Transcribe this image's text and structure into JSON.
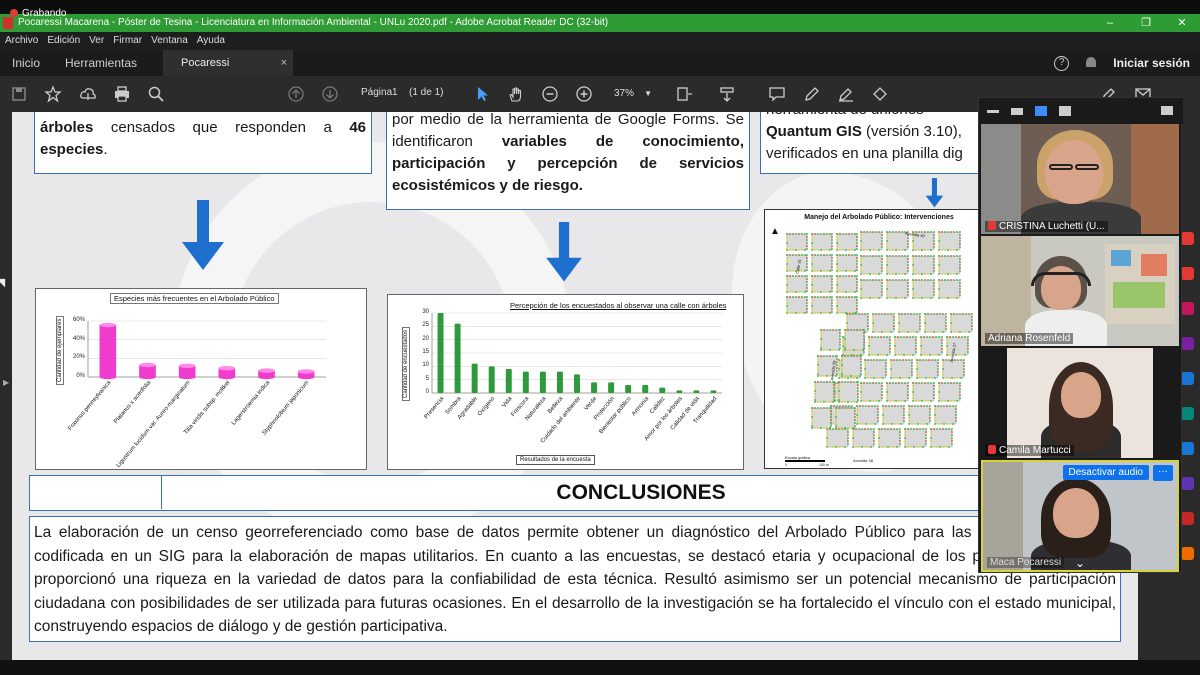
{
  "recording": {
    "label": "Grabando"
  },
  "window": {
    "title": "Pocaressi Macarena - Póster de Tesina - Licenciatura en Información Ambiental - UNLu 2020.pdf - Adobe Acrobat Reader DC (32-bit)",
    "controls": [
      "–",
      "❐",
      "✕"
    ]
  },
  "menu": [
    "Archivo",
    "Edición",
    "Ver",
    "Firmar",
    "Ventana",
    "Ayuda"
  ],
  "tabs": {
    "home": "Inicio",
    "tools": "Herramientas",
    "document": "Pocaressi Macarena...",
    "close": "×",
    "help_icon": "?",
    "login": "Iniciar sesión"
  },
  "toolbar": {
    "page_label": "Página",
    "page_number": "1",
    "page_of": "(1 de 1)",
    "zoom": "37%"
  },
  "poster": {
    "box1": {
      "bold_a": "árboles",
      "text": " censados que responden a ",
      "bold_b": "46 especies",
      "end": "."
    },
    "box2": {
      "text_a": "por medio de la herramienta de Google Forms. Se identificaron ",
      "bold": "variables de conocimiento, participación y percepción de servicios ecosistémicos y de riesgo."
    },
    "box3": {
      "line1": "herramienta    de    uniones",
      "bold": "Quantum GIS",
      "text": " (versión 3.10),",
      "line3": "verificados en una planilla dig"
    },
    "conclusions_title": "CONCLUSIONES",
    "conclusions_text": "La elaboración de un censo georreferenciado como base de datos permite obtener un diagnóstico del Arbolado Público para las tareas municipales, codificada en un SIG para la elaboración de mapas utilitarios. En cuanto a las encuestas, se destacó etaria y ocupacional de los participantes, lo que proporcionó una riqueza en la variedad de datos para la confiabilidad de esta técnica. Resultó asimismo ser un potencial mecanismo de participación ciudadana con posibilidades de ser utilizada para futuras ocasiones. En el desarrollo de la investigación se ha fortalecido el vínculo con el estado municipal, construyendo espacios de diálogo y de gestión participativa.",
    "map": {
      "title": "Manejo del Arbolado Público: Intervenciones",
      "streets": [
        "Avenida 40",
        "Calle 31",
        "Avenida 39",
        "Avenida 37",
        "Avenida 38"
      ],
      "scale": "Escala gráfica",
      "scale_marks": [
        "0",
        "100 m"
      ]
    }
  },
  "chart_data": [
    {
      "type": "bar",
      "title": "Especies más frecuentes en el Arbolado Público",
      "ylabel": "Cantidad de ejemplares",
      "xlabel": "",
      "categories": [
        "Fraxinus pennsylvanica",
        "Platanus x acerifolia",
        "Ligustrum lucidum var. Aureo-marginatum",
        "Tilia viridis subsp. moltkei",
        "Lagerstroemia indica",
        "Styphnolobium japonicum"
      ],
      "values": [
        0.65,
        0.15,
        0.14,
        0.11,
        0.08,
        0.07
      ],
      "yticks": [
        "0%",
        "20%",
        "40%",
        "60%"
      ],
      "ylim": [
        0,
        0.7
      ],
      "color": "#f03ccd"
    },
    {
      "type": "bar",
      "title": "Percepción de los encuestados al observar una calle con árboles",
      "ylabel": "Cantidad de encuestados",
      "xlabel": "Resultados de la encuesta",
      "categories": [
        "Presencia",
        "Sombra",
        "Agradable",
        "Oxígeno",
        "Vida",
        "Frescura",
        "Naturaleza",
        "Belleza",
        "Cuidado del ambiente",
        "Verde",
        "Protección",
        "Bienestar público",
        "Armonía",
        "Calidez",
        "Amor por los árboles",
        "Calidad de vida",
        "Tranquilidad"
      ],
      "values": [
        30,
        26,
        11,
        10,
        9,
        8,
        8,
        8,
        7,
        4,
        4,
        3,
        3,
        2,
        1,
        1,
        1
      ],
      "yticks": [
        "0",
        "5",
        "10",
        "15",
        "20",
        "25",
        "30"
      ],
      "ylim": [
        0,
        30
      ],
      "color": "#2f9a3c"
    }
  ],
  "participants": [
    {
      "name": "CRISTINA Luchetti (U...",
      "muted": true
    },
    {
      "name": "Adriana Rosenfeld",
      "muted": false
    },
    {
      "name": "Camila Martucci",
      "muted": true
    },
    {
      "name": "Maca Pocaressi",
      "muted": false
    }
  ],
  "gallery": {
    "mute_audio": "Desactivar audio",
    "more": "···",
    "chevron": "⌄"
  },
  "colors": {
    "titlebar": "#2e9b34",
    "frame": "#3a6fb8",
    "arrow": "#1f6fce",
    "zoom_blue": "#0e72ed"
  }
}
